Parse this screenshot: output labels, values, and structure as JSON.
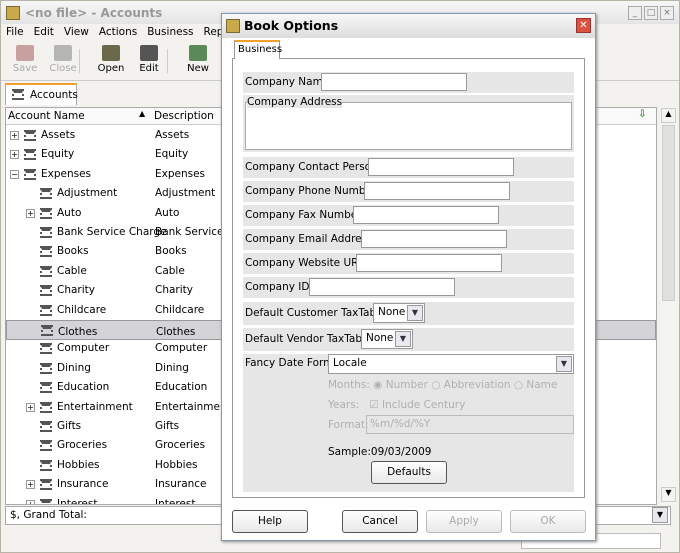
{
  "window": {
    "title": "<no file> - Accounts"
  },
  "menu": [
    "File",
    "Edit",
    "View",
    "Actions",
    "Business",
    "Repo"
  ],
  "toolbar": [
    {
      "label": "Save",
      "enabled": false
    },
    {
      "label": "Close",
      "enabled": false
    },
    {
      "label": "Open",
      "enabled": true
    },
    {
      "label": "Edit",
      "enabled": true
    },
    {
      "label": "New",
      "enabled": true
    }
  ],
  "tab": {
    "label": "Accounts"
  },
  "columns": {
    "name": "Account Name",
    "description": "Description"
  },
  "accounts": [
    {
      "name": "Assets",
      "description": "Assets",
      "level": 0,
      "expander": "+"
    },
    {
      "name": "Equity",
      "description": "Equity",
      "level": 0,
      "expander": "+"
    },
    {
      "name": "Expenses",
      "description": "Expenses",
      "level": 0,
      "expander": "-"
    },
    {
      "name": "Adjustment",
      "description": "Adjustment",
      "level": 1,
      "expander": ""
    },
    {
      "name": "Auto",
      "description": "Auto",
      "level": 1,
      "expander": "+"
    },
    {
      "name": "Bank Service Charge",
      "description": "Bank Service C",
      "level": 1,
      "expander": ""
    },
    {
      "name": "Books",
      "description": "Books",
      "level": 1,
      "expander": ""
    },
    {
      "name": "Cable",
      "description": "Cable",
      "level": 1,
      "expander": ""
    },
    {
      "name": "Charity",
      "description": "Charity",
      "level": 1,
      "expander": ""
    },
    {
      "name": "Childcare",
      "description": "Childcare",
      "level": 1,
      "expander": ""
    },
    {
      "name": "Clothes",
      "description": "Clothes",
      "level": 1,
      "expander": "",
      "selected": true
    },
    {
      "name": "Computer",
      "description": "Computer",
      "level": 1,
      "expander": ""
    },
    {
      "name": "Dining",
      "description": "Dining",
      "level": 1,
      "expander": ""
    },
    {
      "name": "Education",
      "description": "Education",
      "level": 1,
      "expander": ""
    },
    {
      "name": "Entertainment",
      "description": "Entertainment",
      "level": 1,
      "expander": "+"
    },
    {
      "name": "Gifts",
      "description": "Gifts",
      "level": 1,
      "expander": ""
    },
    {
      "name": "Groceries",
      "description": "Groceries",
      "level": 1,
      "expander": ""
    },
    {
      "name": "Hobbies",
      "description": "Hobbies",
      "level": 1,
      "expander": ""
    },
    {
      "name": "Insurance",
      "description": "Insurance",
      "level": 1,
      "expander": "+"
    },
    {
      "name": "Interest",
      "description": "Interest",
      "level": 1,
      "expander": "+"
    }
  ],
  "total": "$, Grand Total:",
  "dialog": {
    "title": "Book Options",
    "tab": "Business",
    "company_name": "Company Name:",
    "company_address": "Company Address",
    "fields": [
      "Company Contact Person:",
      "Company Phone Number:",
      "Company Fax Number:",
      "Company Email Address:",
      "Company Website URL:",
      "Company ID:"
    ],
    "customer_tax": {
      "label": "Default Customer TaxTable:",
      "value": "None"
    },
    "vendor_tax": {
      "label": "Default Vendor TaxTable:",
      "value": "None"
    },
    "date_format": {
      "label": "Fancy Date Format",
      "value": "Locale"
    },
    "months": {
      "label": "Months:",
      "options": [
        "Number",
        "Abbreviation",
        "Name"
      ],
      "selected": "Number"
    },
    "years": {
      "label": "Years:",
      "option": "Include Century",
      "checked": true
    },
    "format": {
      "label": "Format:",
      "value": "%m/%d/%Y"
    },
    "sample": "Sample:09/03/2009",
    "defaults": "Defaults",
    "buttons": {
      "help": "Help",
      "cancel": "Cancel",
      "apply": "Apply",
      "ok": "OK"
    }
  }
}
